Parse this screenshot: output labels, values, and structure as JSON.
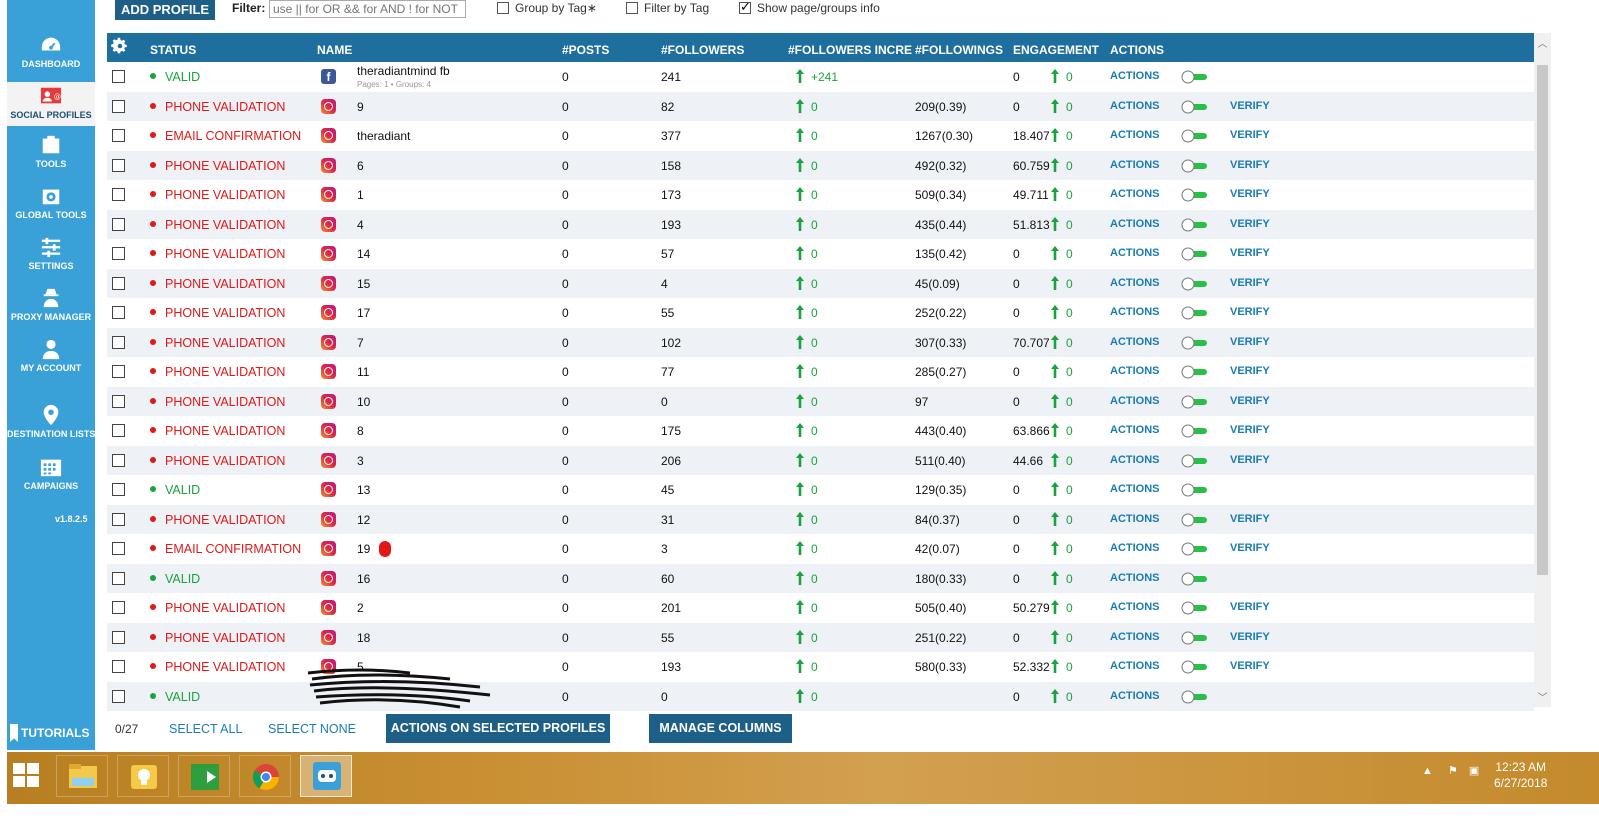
{
  "colors": {
    "sidebar": "#3aa0d8",
    "header": "#1f6f9e",
    "button": "#1d5f86",
    "status_red": "#e01818",
    "status_green": "#1aa33c",
    "link": "#1a7bb5"
  },
  "sidebar": {
    "items": [
      {
        "label": "DASHBOARD",
        "icon": "dashboard-icon"
      },
      {
        "label": "SOCIAL PROFILES",
        "icon": "social-profiles-icon"
      },
      {
        "label": "TOOLS",
        "icon": "tools-icon"
      },
      {
        "label": "GLOBAL TOOLS",
        "icon": "global-tools-icon"
      },
      {
        "label": "SETTINGS",
        "icon": "settings-icon"
      },
      {
        "label": "PROXY MANAGER",
        "icon": "proxy-manager-icon"
      },
      {
        "label": "MY ACCOUNT",
        "icon": "account-icon"
      },
      {
        "label": "DESTINATION LISTS",
        "icon": "location-pin-icon"
      },
      {
        "label": "CAMPAIGNS",
        "icon": "calendar-icon"
      }
    ],
    "version": "v1.8.2.5",
    "tutorials": "TUTORIALS"
  },
  "toolbar": {
    "add_profile": "ADD PROFILE",
    "filter_label": "Filter:",
    "filter_placeholder": "use || for OR && for AND ! for NOT",
    "group_by_tag": "Group by Tag∗",
    "filter_by_tag": "Filter by Tag",
    "show_info": "Show page/groups info"
  },
  "table": {
    "headers": [
      "STATUS",
      "NAME",
      "#POSTS",
      "#FOLLOWERS",
      "#FOLLOWERS INCRE",
      "#FOLLOWINGS",
      "ENGAGEMENT",
      "ACTIONS"
    ],
    "action_label": "ACTIONS",
    "verify_label": "VERIFY",
    "rows": [
      {
        "status": "VALID",
        "ok": true,
        "platform": "facebook",
        "name": "theradiantmind fb",
        "sub": "Pages: 1 • Groups: 4",
        "posts": "0",
        "followers": "241",
        "incr": "+241",
        "followings": "",
        "engagement": "0",
        "eng_incr": "0",
        "verify": false
      },
      {
        "status": "PHONE VALIDATION",
        "ok": false,
        "platform": "instagram",
        "name": "9",
        "posts": "0",
        "followers": "82",
        "incr": "0",
        "followings": "209(0.39)",
        "engagement": "0",
        "eng_incr": "0",
        "verify": true
      },
      {
        "status": "EMAIL CONFIRMATION",
        "ok": false,
        "platform": "instagram",
        "name": "theradiant",
        "posts": "0",
        "followers": "377",
        "incr": "0",
        "followings": "1267(0.30)",
        "engagement": "18.407",
        "eng_incr": "0",
        "verify": true
      },
      {
        "status": "PHONE VALIDATION",
        "ok": false,
        "platform": "instagram",
        "name": "6",
        "posts": "0",
        "followers": "158",
        "incr": "0",
        "followings": "492(0.32)",
        "engagement": "60.759",
        "eng_incr": "0",
        "verify": true
      },
      {
        "status": "PHONE VALIDATION",
        "ok": false,
        "platform": "instagram",
        "name": "1",
        "posts": "0",
        "followers": "173",
        "incr": "0",
        "followings": "509(0.34)",
        "engagement": "49.711",
        "eng_incr": "0",
        "verify": true
      },
      {
        "status": "PHONE VALIDATION",
        "ok": false,
        "platform": "instagram",
        "name": "4",
        "posts": "0",
        "followers": "193",
        "incr": "0",
        "followings": "435(0.44)",
        "engagement": "51.813",
        "eng_incr": "0",
        "verify": true
      },
      {
        "status": "PHONE VALIDATION",
        "ok": false,
        "platform": "instagram",
        "name": "14",
        "posts": "0",
        "followers": "57",
        "incr": "0",
        "followings": "135(0.42)",
        "engagement": "0",
        "eng_incr": "0",
        "verify": true
      },
      {
        "status": "PHONE VALIDATION",
        "ok": false,
        "platform": "instagram",
        "name": "15",
        "posts": "0",
        "followers": "4",
        "incr": "0",
        "followings": "45(0.09)",
        "engagement": "0",
        "eng_incr": "0",
        "verify": true
      },
      {
        "status": "PHONE VALIDATION",
        "ok": false,
        "platform": "instagram",
        "name": "17",
        "posts": "0",
        "followers": "55",
        "incr": "0",
        "followings": "252(0.22)",
        "engagement": "0",
        "eng_incr": "0",
        "verify": true
      },
      {
        "status": "PHONE VALIDATION",
        "ok": false,
        "platform": "instagram",
        "name": "7",
        "posts": "0",
        "followers": "102",
        "incr": "0",
        "followings": "307(0.33)",
        "engagement": "70.707",
        "eng_incr": "0",
        "verify": true
      },
      {
        "status": "PHONE VALIDATION",
        "ok": false,
        "platform": "instagram",
        "name": "11",
        "posts": "0",
        "followers": "77",
        "incr": "0",
        "followings": "285(0.27)",
        "engagement": "0",
        "eng_incr": "0",
        "verify": true
      },
      {
        "status": "PHONE VALIDATION",
        "ok": false,
        "platform": "instagram",
        "name": "10",
        "posts": "0",
        "followers": "0",
        "incr": "0",
        "followings": "97",
        "engagement": "0",
        "eng_incr": "0",
        "verify": true
      },
      {
        "status": "PHONE VALIDATION",
        "ok": false,
        "platform": "instagram",
        "name": "8",
        "posts": "0",
        "followers": "175",
        "incr": "0",
        "followings": "443(0.40)",
        "engagement": "63.866",
        "eng_incr": "0",
        "verify": true
      },
      {
        "status": "PHONE VALIDATION",
        "ok": false,
        "platform": "instagram",
        "name": "3",
        "posts": "0",
        "followers": "206",
        "incr": "0",
        "followings": "511(0.40)",
        "engagement": "44.66",
        "eng_incr": "0",
        "verify": true
      },
      {
        "status": "VALID",
        "ok": true,
        "platform": "instagram",
        "name": "13",
        "posts": "0",
        "followers": "45",
        "incr": "0",
        "followings": "129(0.35)",
        "engagement": "0",
        "eng_incr": "0",
        "verify": false
      },
      {
        "status": "PHONE VALIDATION",
        "ok": false,
        "platform": "instagram",
        "name": "12",
        "posts": "0",
        "followers": "31",
        "incr": "0",
        "followings": "84(0.37)",
        "engagement": "0",
        "eng_incr": "0",
        "verify": true
      },
      {
        "status": "EMAIL CONFIRMATION",
        "ok": false,
        "platform": "instagram",
        "name": "19",
        "badge": true,
        "posts": "0",
        "followers": "3",
        "incr": "0",
        "followings": "42(0.07)",
        "engagement": "0",
        "eng_incr": "0",
        "verify": true
      },
      {
        "status": "VALID",
        "ok": true,
        "platform": "instagram",
        "name": "16",
        "posts": "0",
        "followers": "60",
        "incr": "0",
        "followings": "180(0.33)",
        "engagement": "0",
        "eng_incr": "0",
        "verify": false
      },
      {
        "status": "PHONE VALIDATION",
        "ok": false,
        "platform": "instagram",
        "name": "2",
        "posts": "0",
        "followers": "201",
        "incr": "0",
        "followings": "505(0.40)",
        "engagement": "50.279",
        "eng_incr": "0",
        "verify": true
      },
      {
        "status": "PHONE VALIDATION",
        "ok": false,
        "platform": "instagram",
        "name": "18",
        "posts": "0",
        "followers": "55",
        "incr": "0",
        "followings": "251(0.22)",
        "engagement": "0",
        "eng_incr": "0",
        "verify": true
      },
      {
        "status": "PHONE VALIDATION",
        "ok": false,
        "platform": "instagram",
        "name": "5",
        "posts": "0",
        "followers": "193",
        "incr": "0",
        "followings": "580(0.33)",
        "engagement": "52.332",
        "eng_incr": "0",
        "verify": true
      },
      {
        "status": "VALID",
        "ok": true,
        "platform": "hidden",
        "name": "",
        "posts": "0",
        "followers": "0",
        "incr": "0",
        "followings": "",
        "engagement": "0",
        "eng_incr": "0",
        "verify": false
      }
    ]
  },
  "footer": {
    "count": "0/27",
    "select_all": "SELECT ALL",
    "select_none": "SELECT NONE",
    "actions_on_selected": "ACTIONS ON SELECTED PROFILES",
    "manage_columns": "MANAGE COLUMNS"
  },
  "taskbar": {
    "time": "12:23 AM",
    "date": "6/27/2018",
    "apps": [
      "file-explorer-icon",
      "lightbulb-icon",
      "green-arrow-app-icon",
      "chrome-icon",
      "robot-app-icon"
    ]
  }
}
